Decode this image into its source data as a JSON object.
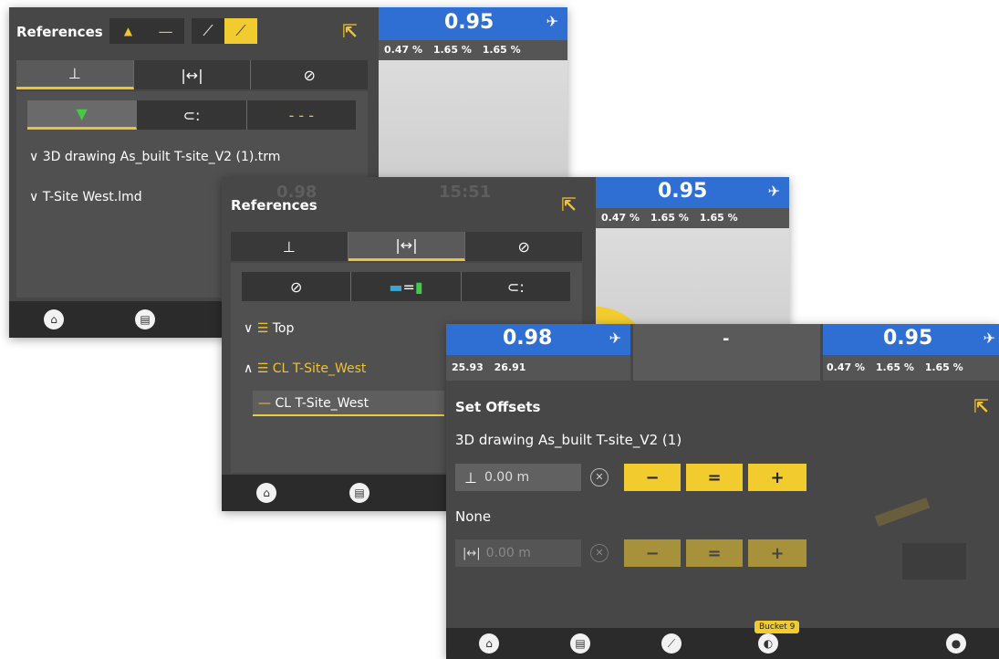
{
  "panel1": {
    "title": "References",
    "blue_value": "0.95",
    "strip": [
      "0.47 %",
      "1.65 %",
      "1.65 %"
    ],
    "rows": [
      "3D drawing As_built T-site_V2 (1).trm",
      "T-Site West.lmd"
    ]
  },
  "panel2": {
    "title": "References",
    "bg_numbers": [
      "0.98",
      "15:51"
    ],
    "blue_value": "0.95",
    "strip": [
      "0.47 %",
      "1.65 %",
      "1.65 %"
    ],
    "rows": [
      "Top",
      "CL T-Site_West"
    ],
    "selected_item": "CL T-Site_West"
  },
  "panel3": {
    "left_value": "0.98",
    "left_strip": [
      "25.93",
      "26.91"
    ],
    "middle_value": "-",
    "right_value": "0.95",
    "right_strip": [
      "0.47 %",
      "1.65 %",
      "1.65 %"
    ],
    "title": "Set Offsets",
    "ref1": "3D drawing As_built T-site_V2 (1)",
    "field1": "0.00 m",
    "ref2": "None",
    "field2": "0.00 m",
    "minus": "−",
    "equals": "=",
    "plus": "+",
    "bucket_badge": "Bucket 9"
  },
  "colors": {
    "accent_yellow": "#f2cc2f",
    "blue": "#2f6fd3",
    "panel_dark": "#474747"
  },
  "icons": [
    "home-icon",
    "machine-icon",
    "design-icon",
    "bucket-icon",
    "external-link-icon",
    "chevron-down-icon",
    "chevron-up-icon"
  ]
}
